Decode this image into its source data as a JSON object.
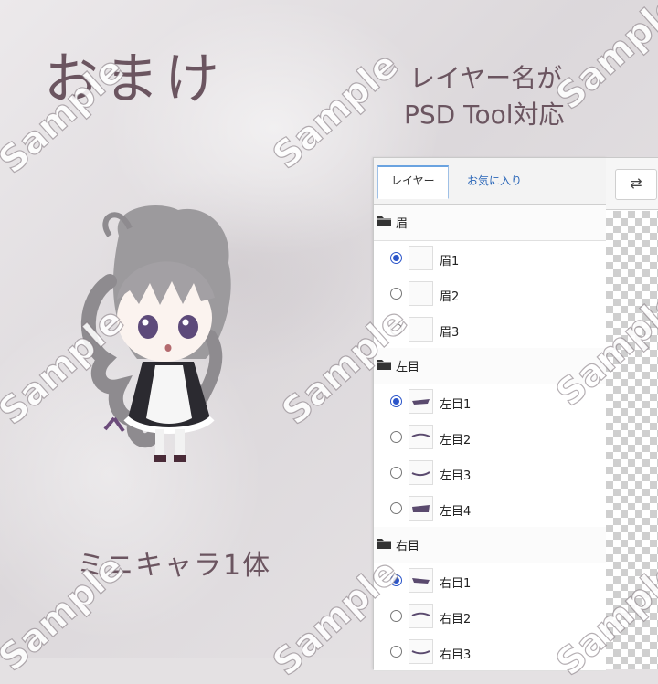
{
  "texts": {
    "omake": "おまけ",
    "layer_name_line1": "レイヤー名が",
    "layer_name_line2": "PSD Tool対応",
    "mini_chara": "ミニキャラ1体"
  },
  "watermark": "Sample",
  "panel": {
    "tabs": [
      {
        "label": "レイヤー",
        "active": true
      },
      {
        "label": "お気に入り",
        "active": false
      }
    ],
    "groups": [
      {
        "name": "眉",
        "icon": "folder-icon"
      },
      {
        "name": "左目",
        "icon": "folder-icon"
      },
      {
        "name": "右目",
        "icon": "folder-icon"
      }
    ],
    "layers": [
      {
        "name": "眉1",
        "selected": true
      },
      {
        "name": "眉2",
        "selected": false
      },
      {
        "name": "眉3",
        "selected": false
      },
      {
        "name": "左目1",
        "selected": true
      },
      {
        "name": "左目2",
        "selected": false
      },
      {
        "name": "左目3",
        "selected": false
      },
      {
        "name": "左目4",
        "selected": false
      },
      {
        "name": "右目1",
        "selected": true
      },
      {
        "name": "右目2",
        "selected": false
      },
      {
        "name": "右目3",
        "selected": false
      }
    ]
  },
  "preview": {
    "swap_icon": "⇄"
  },
  "colors": {
    "title": "#6b5560",
    "radio_selected": "#2b55c9",
    "tab_link": "#2a66b8"
  }
}
